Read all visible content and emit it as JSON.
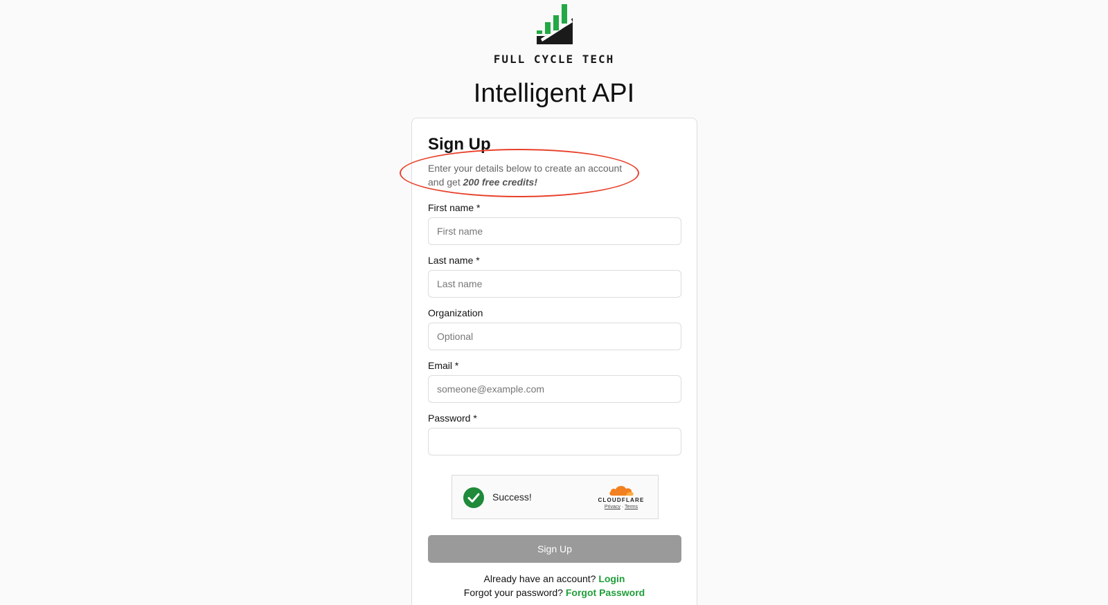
{
  "brand": {
    "name": "FULL CYCLE TECH",
    "logo_icon": "bar-chart-growth-icon",
    "colors": {
      "green": "#22a845",
      "dark": "#1a1a1a"
    }
  },
  "app_title": "Intelligent API",
  "form": {
    "title": "Sign Up",
    "description_prefix": "Enter your details below to create an account and get ",
    "description_emphasis": "200 free credits!",
    "fields": {
      "first_name": {
        "label": "First name *",
        "placeholder": "First name",
        "value": ""
      },
      "last_name": {
        "label": "Last name *",
        "placeholder": "Last name",
        "value": ""
      },
      "organization": {
        "label": "Organization",
        "placeholder": "Optional",
        "value": ""
      },
      "email": {
        "label": "Email *",
        "placeholder": "someone@example.com",
        "value": ""
      },
      "password": {
        "label": "Password *",
        "placeholder": "",
        "value": ""
      }
    },
    "captcha": {
      "status": "Success!",
      "provider": "CLOUDFLARE",
      "privacy": "Privacy",
      "separator": "·",
      "terms": "Terms",
      "icon": "checkmark-circle-icon",
      "status_color": "#1e8a3a",
      "provider_color": "#f38020"
    },
    "submit_label": "Sign Up",
    "login_prompt": "Already have an account?",
    "login_link": "Login",
    "forgot_prompt": "Forgot your password?",
    "forgot_link": "Forgot Password",
    "link_color": "#1f9e3a",
    "annotation_color": "#e8402a"
  }
}
